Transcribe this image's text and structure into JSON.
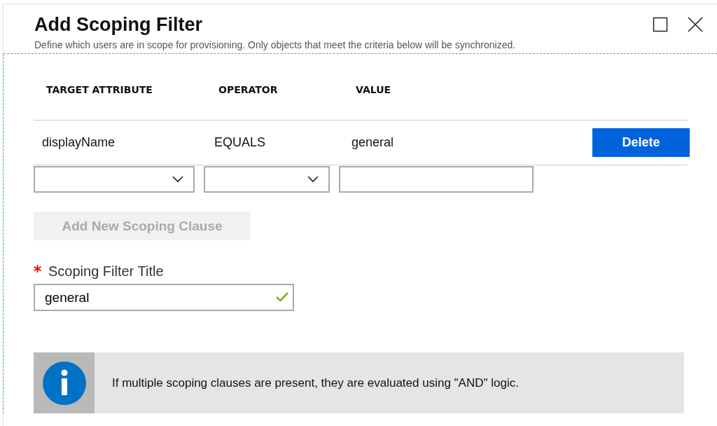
{
  "blade": {
    "title": "Add Scoping Filter",
    "subtitle": "Define which users are in scope for provisioning. Only objects that meet the criteria below will be synchronized."
  },
  "table": {
    "columns": [
      "TARGET ATTRIBUTE",
      "OPERATOR",
      "VALUE"
    ],
    "rows": [
      {
        "attribute": "displayName",
        "operator": "EQUALS",
        "value": "general",
        "action": "Delete"
      }
    ]
  },
  "add_button": {
    "label": "Add New Scoping Clause",
    "disabled": true
  },
  "title_field": {
    "label": "Scoping Filter Title",
    "required": true,
    "value": "general",
    "valid": true
  },
  "info": {
    "message": "If multiple scoping clauses are present, they are evaluated using \"AND\" logic."
  }
}
